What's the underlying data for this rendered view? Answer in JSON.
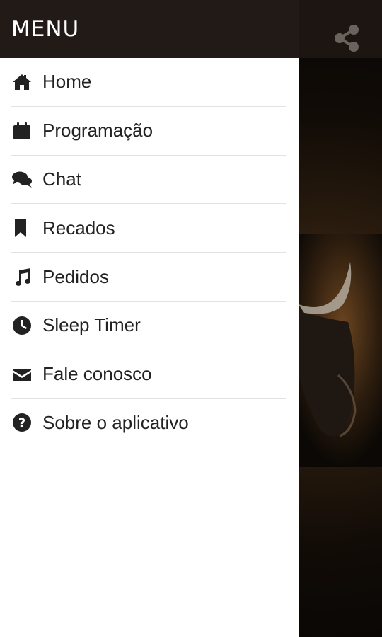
{
  "drawer": {
    "title": "MENU",
    "items": [
      {
        "label": "Home",
        "icon": "home-icon"
      },
      {
        "label": "Programação",
        "icon": "calendar-icon"
      },
      {
        "label": "Chat",
        "icon": "chat-icon"
      },
      {
        "label": "Recados",
        "icon": "bookmark-icon"
      },
      {
        "label": "Pedidos",
        "icon": "music-icon"
      },
      {
        "label": "Sleep Timer",
        "icon": "clock-icon"
      },
      {
        "label": "Fale conosco",
        "icon": "envelope-icon"
      },
      {
        "label": "Sobre o aplicativo",
        "icon": "question-icon"
      }
    ]
  },
  "app": {
    "share_icon": "share-icon"
  },
  "colors": {
    "drawer_header": "#221a16",
    "drawer_bg": "#ffffff",
    "text": "#222222",
    "divider": "#e2e2e2"
  }
}
